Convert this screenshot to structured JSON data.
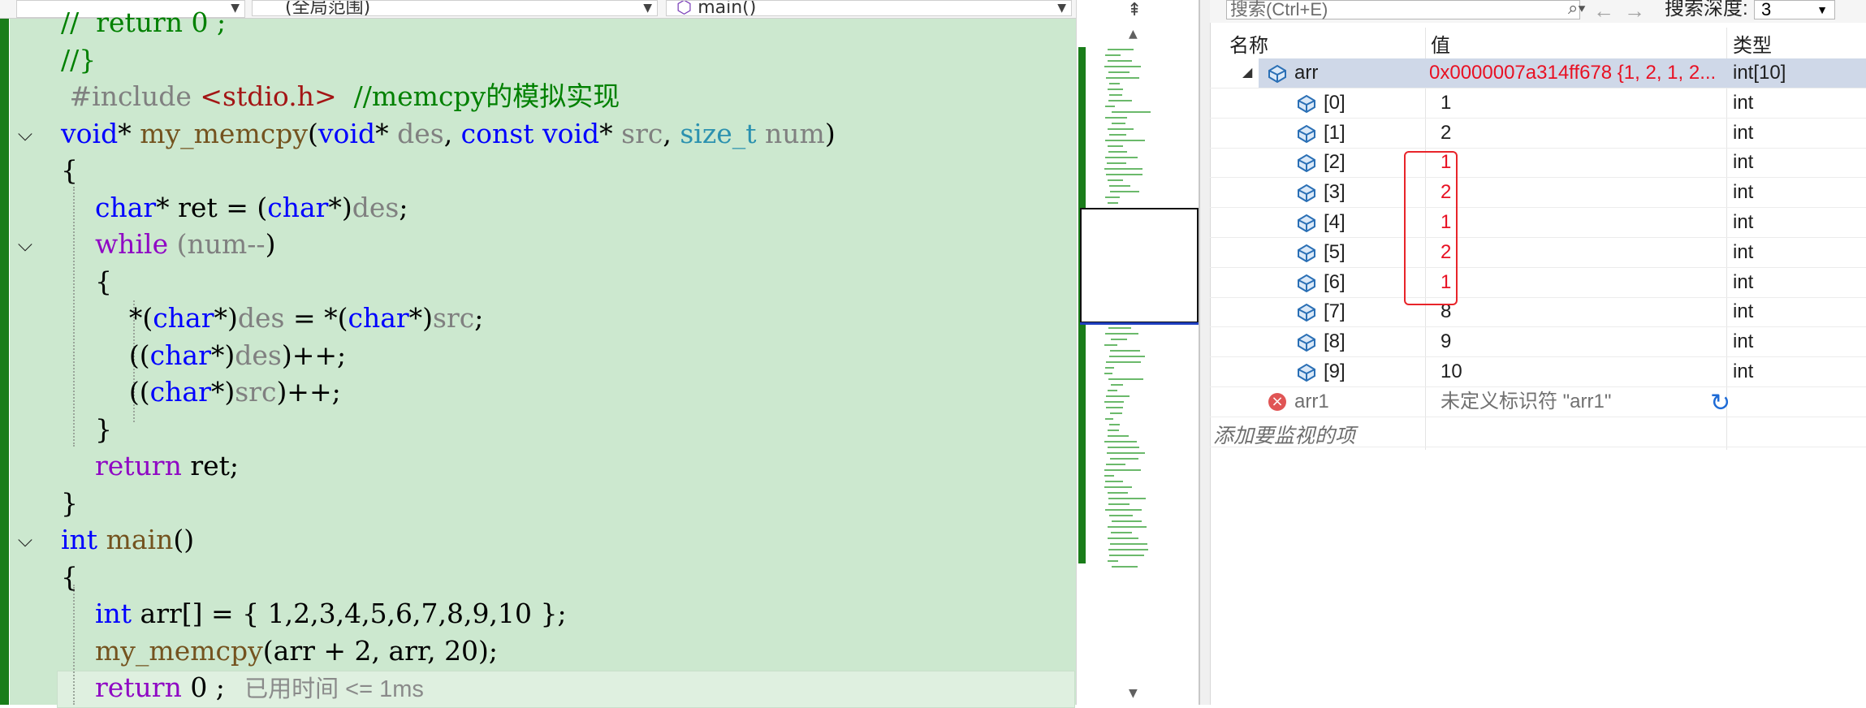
{
  "editor": {
    "nav": {
      "scope": "(全局范围)",
      "function": "main()"
    },
    "lines": [
      {
        "parts": [
          [
            "cm",
            "//  return 0 ;"
          ]
        ]
      },
      {
        "parts": [
          [
            "cm",
            "//}"
          ]
        ]
      },
      {
        "parts": [
          [
            "pp",
            " #include "
          ],
          [
            "st",
            "<stdio.h>"
          ],
          [
            "cm",
            "  //memcpy的模拟实现"
          ]
        ]
      },
      {
        "parts": [
          [
            "k",
            "void"
          ],
          [
            "",
            "* "
          ],
          [
            "fn",
            "my_memcpy"
          ],
          [
            "",
            "("
          ],
          [
            "k",
            "void"
          ],
          [
            "",
            "* "
          ],
          [
            "pm",
            "des"
          ],
          [
            "",
            ", "
          ],
          [
            "k",
            "const void"
          ],
          [
            "",
            "* "
          ],
          [
            "pm",
            "src"
          ],
          [
            "",
            ", "
          ],
          [
            "ty",
            "size_t"
          ],
          [
            "pm",
            " num"
          ],
          [
            "",
            ")"
          ]
        ]
      },
      {
        "parts": [
          [
            "",
            "{"
          ]
        ]
      },
      {
        "parts": [
          [
            "",
            "    "
          ],
          [
            "k",
            "char"
          ],
          [
            "",
            "* ret = ("
          ],
          [
            "k",
            "char"
          ],
          [
            "",
            "*)"
          ],
          [
            "pm",
            "des"
          ],
          [
            "",
            ";"
          ]
        ]
      },
      {
        "parts": [
          [
            "",
            "    "
          ],
          [
            "kp",
            "while"
          ],
          [
            "pm",
            " ("
          ],
          [
            "pm",
            "num--"
          ],
          [
            "",
            ")"
          ]
        ]
      },
      {
        "parts": [
          [
            "",
            "    {"
          ]
        ]
      },
      {
        "parts": [
          [
            "",
            "        *("
          ],
          [
            "k",
            "char"
          ],
          [
            "",
            "*)"
          ],
          [
            "pm",
            "des"
          ],
          [
            "",
            " = *("
          ],
          [
            "k",
            "char"
          ],
          [
            "",
            "*)"
          ],
          [
            "pm",
            "src"
          ],
          [
            "",
            ";"
          ]
        ]
      },
      {
        "parts": [
          [
            "",
            "        (("
          ],
          [
            "k",
            "char"
          ],
          [
            "",
            "*)"
          ],
          [
            "pm",
            "des"
          ],
          [
            "",
            ")++;"
          ]
        ]
      },
      {
        "parts": [
          [
            "",
            "        (("
          ],
          [
            "k",
            "char"
          ],
          [
            "",
            "*)"
          ],
          [
            "pm",
            "src"
          ],
          [
            "",
            ")++;"
          ]
        ]
      },
      {
        "parts": [
          [
            "",
            "    }"
          ]
        ]
      },
      {
        "parts": [
          [
            "",
            "    "
          ],
          [
            "kp",
            "return"
          ],
          [
            "",
            " ret;"
          ]
        ]
      },
      {
        "parts": [
          [
            "",
            "}"
          ]
        ]
      },
      {
        "parts": [
          [
            "k",
            "int"
          ],
          [
            "",
            " "
          ],
          [
            "fn",
            "main"
          ],
          [
            "",
            "()"
          ]
        ]
      },
      {
        "parts": [
          [
            "",
            "{"
          ]
        ]
      },
      {
        "parts": [
          [
            "",
            "    "
          ],
          [
            "k",
            "int"
          ],
          [
            "",
            " arr[] = { 1,2,3,4,5,6,7,8,9,10 };"
          ]
        ]
      },
      {
        "parts": [
          [
            "",
            "    "
          ],
          [
            "fn",
            "my_memcpy"
          ],
          [
            "",
            "(arr + 2, arr, 20);"
          ]
        ]
      },
      {
        "parts": [
          [
            "",
            "    "
          ],
          [
            "kp",
            "return"
          ],
          [
            "",
            " 0 ;"
          ]
        ]
      }
    ],
    "perf_tip": "已用时间 <= 1ms"
  },
  "watch": {
    "search_placeholder": "搜索(Ctrl+E)",
    "depth_label": "搜索深度:",
    "depth_value": "3",
    "columns": {
      "name": "名称",
      "value": "值",
      "type": "类型"
    },
    "root": {
      "name": "arr",
      "value": "0x0000007a314ff678 {1, 2, 1, 2...",
      "type": "int[10]"
    },
    "items": [
      {
        "name": "[0]",
        "value": "1",
        "type": "int",
        "changed": false
      },
      {
        "name": "[1]",
        "value": "2",
        "type": "int",
        "changed": false
      },
      {
        "name": "[2]",
        "value": "1",
        "type": "int",
        "changed": true
      },
      {
        "name": "[3]",
        "value": "2",
        "type": "int",
        "changed": true
      },
      {
        "name": "[4]",
        "value": "1",
        "type": "int",
        "changed": true
      },
      {
        "name": "[5]",
        "value": "2",
        "type": "int",
        "changed": true
      },
      {
        "name": "[6]",
        "value": "1",
        "type": "int",
        "changed": true
      },
      {
        "name": "[7]",
        "value": "8",
        "type": "int",
        "changed": false
      },
      {
        "name": "[8]",
        "value": "9",
        "type": "int",
        "changed": false
      },
      {
        "name": "[9]",
        "value": "10",
        "type": "int",
        "changed": false
      }
    ],
    "error_row": {
      "name": "arr1",
      "value": "未定义标识符 \"arr1\""
    },
    "add_watch": "添加要监视的项"
  },
  "colors": {
    "editor_bg": "#cce8cf",
    "change_red": "#e81123",
    "gutter_green": "#1a7d1a"
  }
}
